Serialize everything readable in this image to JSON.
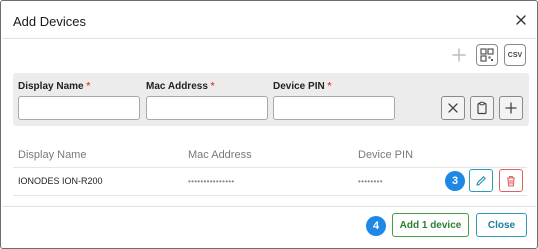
{
  "dialog": {
    "title": "Add Devices",
    "close_icon": "close-icon"
  },
  "toolbar": {
    "add_icon": "plus-icon",
    "qr_icon": "qr-code-icon",
    "csv_label": "CSV"
  },
  "form": {
    "display_name": {
      "label": "Display Name",
      "required_mark": "*",
      "value": ""
    },
    "mac_address": {
      "label": "Mac Address",
      "required_mark": "*",
      "value": ""
    },
    "device_pin": {
      "label": "Device PIN",
      "required_mark": "*",
      "value": ""
    },
    "actions": [
      "clear-icon",
      "paste-icon",
      "plus-icon"
    ]
  },
  "table": {
    "columns": [
      "Display Name",
      "Mac Address",
      "Device PIN"
    ],
    "rows": [
      {
        "display_name": "IONODES ION-R200",
        "mac_address": "•••••••••••••••",
        "device_pin": "••••••••"
      }
    ],
    "step_badge": "3",
    "edit_icon": "pencil-icon",
    "delete_icon": "trash-icon"
  },
  "footer": {
    "step_badge": "4",
    "add_label": "Add 1 device",
    "close_label": "Close"
  },
  "colors": {
    "accent_blue": "#1e88e5",
    "teal": "#2a9bb8",
    "green": "#43a047",
    "danger": "#e06060",
    "required": "#e04848"
  }
}
